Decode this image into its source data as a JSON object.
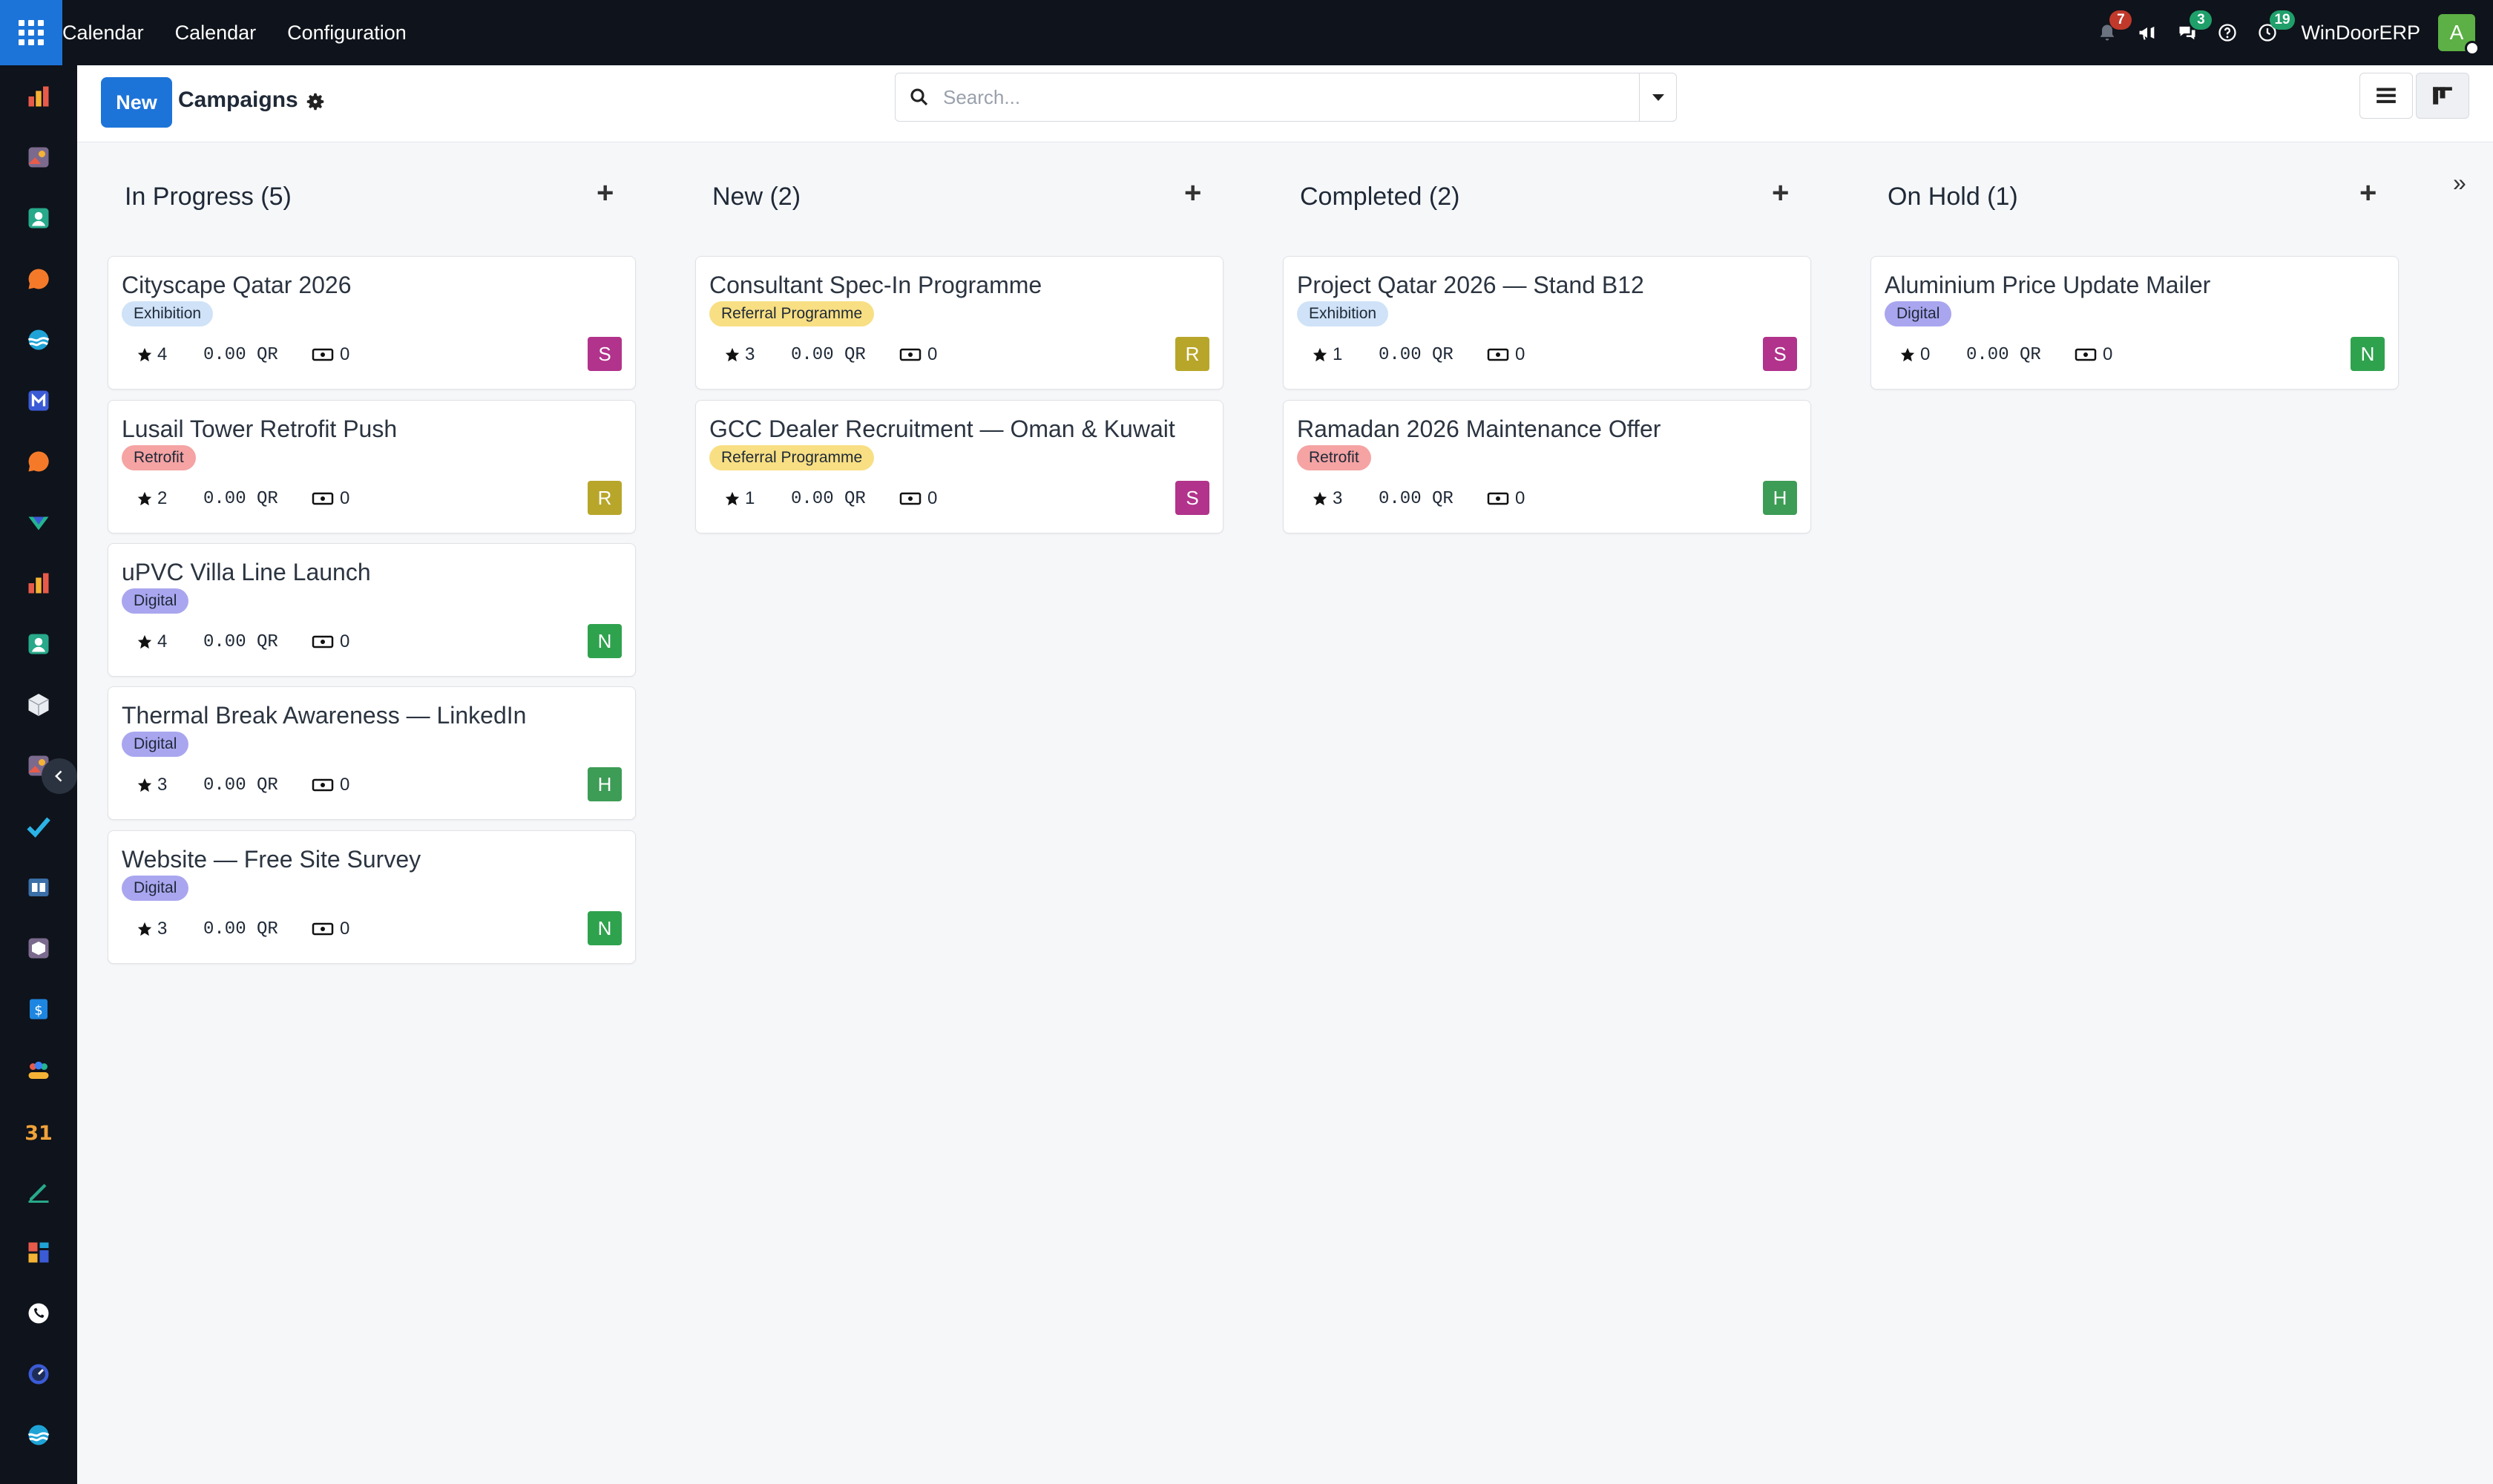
{
  "topbar": {
    "menu": [
      "Calendar",
      "Calendar",
      "Configuration"
    ],
    "notifications_badge": "7",
    "messages_badge": "3",
    "activities_badge": "19",
    "company": "WinDoorERP",
    "user_initial": "A"
  },
  "control": {
    "new_label": "New",
    "title": "Campaigns",
    "search_placeholder": "Search..."
  },
  "kanban": {
    "expand_icon": "»",
    "columns": [
      {
        "title": "In Progress (5)",
        "cards": [
          {
            "title": "Cityscape Qatar 2026",
            "tag": "Exhibition",
            "tag_color": "#cfe2f7",
            "stars": "4",
            "amount": "0.00 QR",
            "count": "0",
            "assignee": "S",
            "assignee_color": "#b1338b"
          },
          {
            "title": "Lusail Tower Retrofit Push",
            "tag": "Retrofit",
            "tag_color": "#f5a3a3",
            "stars": "2",
            "amount": "0.00 QR",
            "count": "0",
            "assignee": "R",
            "assignee_color": "#b8a62a"
          },
          {
            "title": "uPVC Villa Line Launch",
            "tag": "Digital",
            "tag_color": "#a9a6ef",
            "stars": "4",
            "amount": "0.00 QR",
            "count": "0",
            "assignee": "N",
            "assignee_color": "#2fa24e"
          },
          {
            "title": "Thermal Break Awareness — LinkedIn",
            "tag": "Digital",
            "tag_color": "#a9a6ef",
            "stars": "3",
            "amount": "0.00 QR",
            "count": "0",
            "assignee": "H",
            "assignee_color": "#3d9c55"
          },
          {
            "title": "Website — Free Site Survey",
            "tag": "Digital",
            "tag_color": "#a9a6ef",
            "stars": "3",
            "amount": "0.00 QR",
            "count": "0",
            "assignee": "N",
            "assignee_color": "#2fa24e"
          }
        ]
      },
      {
        "title": "New (2)",
        "cards": [
          {
            "title": "Consultant Spec-In Programme",
            "tag": "Referral Programme",
            "tag_color": "#f8df83",
            "stars": "3",
            "amount": "0.00 QR",
            "count": "0",
            "assignee": "R",
            "assignee_color": "#b8a62a"
          },
          {
            "title": "GCC Dealer Recruitment — Oman & Kuwait",
            "tag": "Referral Programme",
            "tag_color": "#f8df83",
            "stars": "1",
            "amount": "0.00 QR",
            "count": "0",
            "assignee": "S",
            "assignee_color": "#b1338b"
          }
        ]
      },
      {
        "title": "Completed (2)",
        "cards": [
          {
            "title": "Project Qatar 2026 — Stand B12",
            "tag": "Exhibition",
            "tag_color": "#cfe2f7",
            "stars": "1",
            "amount": "0.00 QR",
            "count": "0",
            "assignee": "S",
            "assignee_color": "#b1338b"
          },
          {
            "title": "Ramadan 2026 Maintenance Offer",
            "tag": "Retrofit",
            "tag_color": "#f5a3a3",
            "stars": "3",
            "amount": "0.00 QR",
            "count": "0",
            "assignee": "H",
            "assignee_color": "#3d9c55"
          }
        ]
      },
      {
        "title": "On Hold (1)",
        "cards": [
          {
            "title": "Aluminium Price Update Mailer",
            "tag": "Digital",
            "tag_color": "#a9a6ef",
            "stars": "0",
            "amount": "0.00 QR",
            "count": "0",
            "assignee": "N",
            "assignee_color": "#2fa24e"
          }
        ]
      }
    ]
  },
  "sidebar": {
    "icons": [
      "chart-app-icon",
      "photo-app-icon",
      "contacts-app-icon",
      "chat-app-icon",
      "wave-app-icon",
      "mail-app-icon",
      "chat2-app-icon",
      "check-app-icon",
      "chart2-app-icon",
      "contacts2-app-icon",
      "box-app-icon",
      "photo2-app-icon",
      "checkmark-app-icon",
      "book-app-icon",
      "package-app-icon",
      "invoice-app-icon",
      "team-app-icon",
      "calendar-app-icon",
      "sign-app-icon",
      "dashboard-app-icon",
      "whatsapp-app-icon",
      "clock-app-icon",
      "wave2-app-icon"
    ],
    "calendar_day": "31"
  }
}
